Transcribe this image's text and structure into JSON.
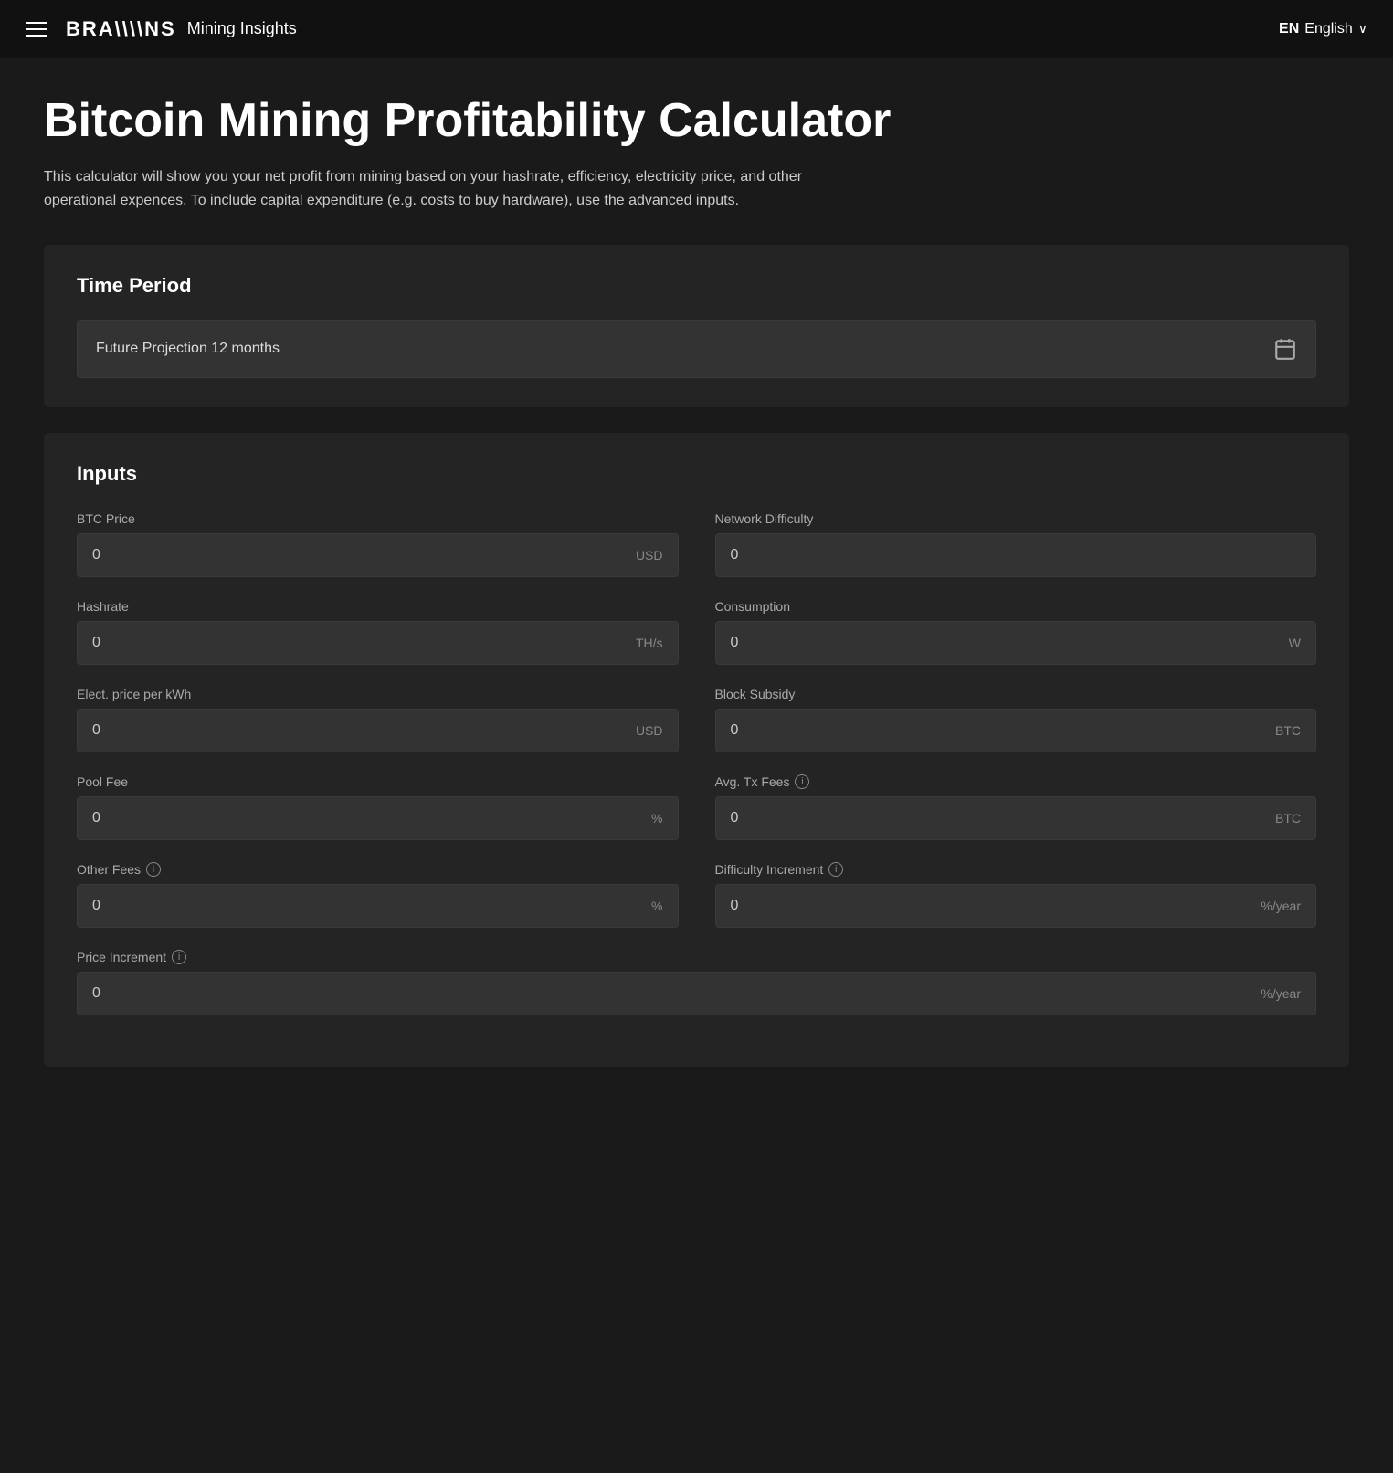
{
  "navbar": {
    "brand_logo": "BRA\\NS",
    "brand_subtitle": "Mining Insights",
    "lang_code": "EN",
    "lang_name": "English"
  },
  "page": {
    "title": "Bitcoin Mining Profitability Calculator",
    "description": "This calculator will show you your net profit from mining based on your hashrate, efficiency, electricity price, and other operational expences. To include capital expenditure (e.g. costs to buy hardware), use the advanced inputs."
  },
  "time_period": {
    "section_title": "Time Period",
    "selected_value": "Future Projection 12 months"
  },
  "inputs": {
    "section_title": "Inputs",
    "fields": [
      {
        "id": "btc-price",
        "label": "BTC Price",
        "value": "0",
        "unit": "USD",
        "has_info": false,
        "full_width": false
      },
      {
        "id": "network-difficulty",
        "label": "Network Difficulty",
        "value": "0",
        "unit": "",
        "has_info": false,
        "full_width": false
      },
      {
        "id": "hashrate",
        "label": "Hashrate",
        "value": "0",
        "unit": "TH/s",
        "has_info": false,
        "full_width": false
      },
      {
        "id": "consumption",
        "label": "Consumption",
        "value": "0",
        "unit": "W",
        "has_info": false,
        "full_width": false
      },
      {
        "id": "elec-price",
        "label": "Elect. price per kWh",
        "value": "0",
        "unit": "USD",
        "has_info": false,
        "full_width": false
      },
      {
        "id": "block-subsidy",
        "label": "Block Subsidy",
        "value": "0",
        "unit": "BTC",
        "has_info": false,
        "full_width": false
      },
      {
        "id": "pool-fee",
        "label": "Pool Fee",
        "value": "0",
        "unit": "%",
        "has_info": false,
        "full_width": false
      },
      {
        "id": "avg-tx-fees",
        "label": "Avg. Tx Fees",
        "value": "0",
        "unit": "BTC",
        "has_info": true,
        "full_width": false
      },
      {
        "id": "other-fees",
        "label": "Other Fees",
        "value": "0",
        "unit": "%",
        "has_info": true,
        "full_width": false
      },
      {
        "id": "difficulty-increment",
        "label": "Difficulty Increment",
        "value": "0",
        "unit": "%/year",
        "has_info": true,
        "full_width": false
      },
      {
        "id": "price-increment",
        "label": "Price Increment",
        "value": "0",
        "unit": "%/year",
        "has_info": true,
        "full_width": true
      }
    ]
  },
  "icons": {
    "info": "i",
    "calendar": "📅",
    "chevron_down": "∨"
  }
}
